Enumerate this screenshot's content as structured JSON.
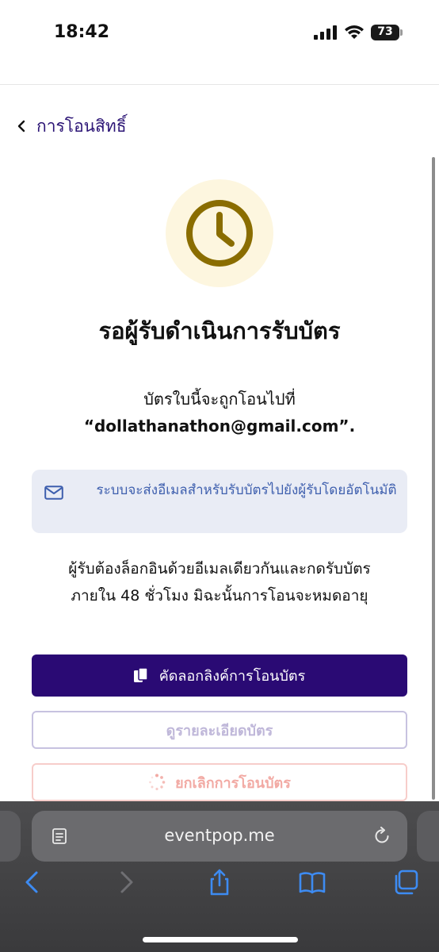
{
  "status_bar": {
    "time": "18:42",
    "battery_level": "73",
    "icons": [
      "cellular-signal-icon",
      "wifi-icon",
      "battery-icon"
    ]
  },
  "header": {
    "back_label": "การโอนสิทธิ์",
    "back_icon": "chevron-left-icon"
  },
  "main": {
    "status_icon": "clock-icon",
    "title": "รอผู้รับดำเนินการรับบัตร",
    "desc_line1": "บัตรใบนี้จะถูกโอนไปที่",
    "recipient_email": "“dollathanathon@gmail.com”.",
    "info_box": {
      "icon": "mail-icon",
      "text": "ระบบจะส่งอีเมลสำหรับรับบัตรไปยังผู้รับโดยอัตโนมัติ"
    },
    "note_line1": "ผู้รับต้องล็อกอินด้วยอีเมลเดียวกันและกดรับบัตร",
    "note_line2": "ภายใน 48 ชั่วโมง มิฉะนั้นการโอนจะหมดอายุ"
  },
  "actions": {
    "copy_link_label": "คัดลอกลิงค์การโอนบัตร",
    "view_details_label": "ดูรายละเอียดบัตร",
    "cancel_transfer_label": "ยกเลิกการโอนบัตร"
  },
  "browser": {
    "url": "eventpop.me",
    "toolbar_icons": [
      "back-icon",
      "forward-icon",
      "share-icon",
      "bookmarks-icon",
      "tabs-icon"
    ]
  },
  "colors": {
    "primary": "#2a0a74",
    "accent_text": "#2b1475",
    "clock_gold": "#8a6d00",
    "clock_bg": "#fdf6df",
    "info_bg": "#e9ecf5",
    "info_text": "#3e5fae",
    "danger_border": "#f7cdca",
    "toolbar_blue": "#3d8bf2"
  }
}
